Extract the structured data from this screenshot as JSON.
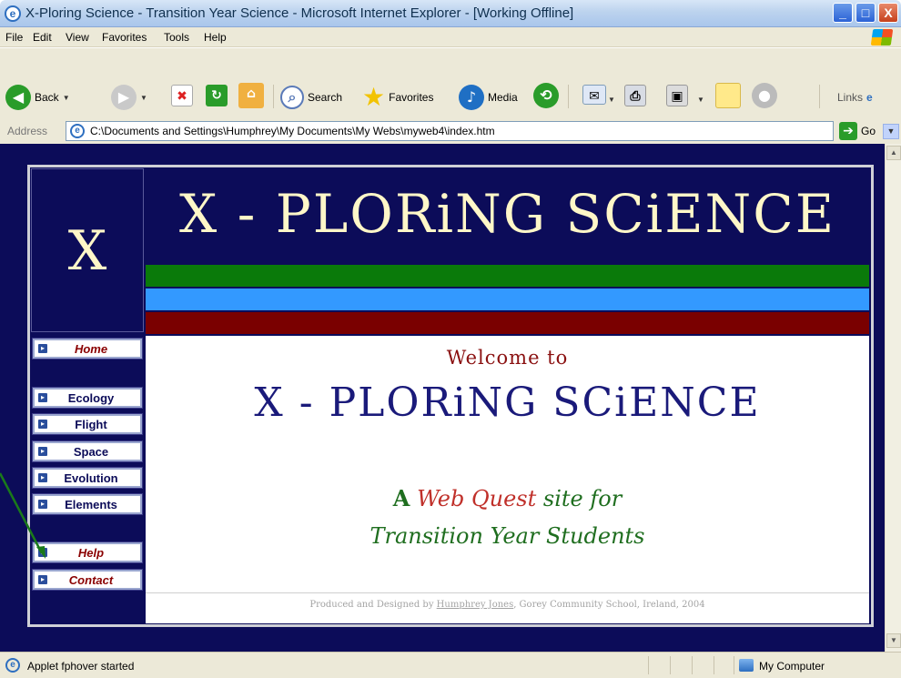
{
  "window": {
    "title": "X-Ploring Science - Transition Year Science - Microsoft Internet Explorer - [Working Offline]",
    "min_glyph": "_",
    "max_glyph": "□",
    "close_glyph": "X"
  },
  "menu": [
    "File",
    "Edit",
    "View",
    "Favorites",
    "Tools",
    "Help"
  ],
  "toolbar": {
    "back_label": "Back",
    "search_label": "Search",
    "favorites_label": "Favorites",
    "media_label": "Media",
    "links_label": "Links"
  },
  "address": {
    "label": "Address",
    "value": "C:\\Documents and Settings\\Humphrey\\My Documents\\My Webs\\myweb4\\index.htm",
    "go_label": "Go"
  },
  "page": {
    "logo_letter": "X",
    "banner_title": "X - PLORiNG SCiENCE",
    "nav_items": [
      {
        "label": "Home",
        "style": "red"
      },
      {
        "label": "Ecology",
        "style": "blue"
      },
      {
        "label": "Flight",
        "style": "blue"
      },
      {
        "label": "Space",
        "style": "blue"
      },
      {
        "label": "Evolution",
        "style": "blue"
      },
      {
        "label": "Elements",
        "style": "blue"
      },
      {
        "label": "Help",
        "style": "red"
      },
      {
        "label": "Contact",
        "style": "red"
      }
    ],
    "welcome": "Welcome to",
    "main_title": "X - PLORiNG SCiENCE",
    "tagline_a": "A",
    "tagline_webquest": "Web Quest",
    "tagline_rest": "site for",
    "tagline_line2": "Transition Year Students",
    "footer_prefix": "Produced and Designed by",
    "footer_author": "Humphrey Jones",
    "footer_suffix": ", Gorey Community School, Ireland, 2004",
    "colors": {
      "page_bg": "#0c0c59",
      "banner_text": "#fff7c8",
      "stripe_green": "#0a7a0a",
      "stripe_blue": "#3399ff",
      "stripe_red": "#7a0000",
      "title_blue": "#1a1a7a",
      "tagline_green": "#1f6e1f",
      "tagline_red": "#c0302a",
      "annotation_arrow": "#1a7a1a"
    }
  },
  "status": {
    "text": "Applet fphover started",
    "zone": "My Computer"
  }
}
